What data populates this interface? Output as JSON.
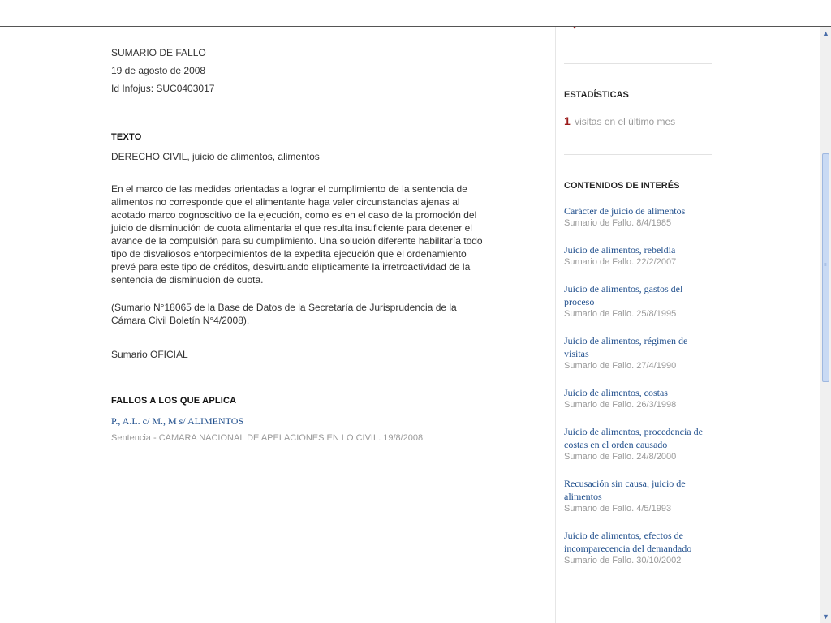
{
  "summary": {
    "type_label": "SUMARIO DE FALLO",
    "date": "19 de agosto de 2008",
    "id_line": "Id Infojus: SUC0403017"
  },
  "texto": {
    "title": "TEXTO",
    "keywords": "DERECHO CIVIL, juicio de alimentos, alimentos",
    "paragraph": "En el marco de las medidas orientadas a lograr el cumplimiento de la sentencia de alimentos no corresponde que el alimentante haga valer circunstancias ajenas al acotado marco cognoscitivo de la ejecución, como es en el caso de la promoción del juicio de disminución de cuota alimentaria el que resulta insuficiente para detener el avance de la compulsión para su cumplimiento. Una solución diferente habilitaría todo tipo de disvaliosos entorpecimientos de la expedita ejecución que el ordenamiento prevé para este tipo de créditos, desvirtuando elípticamente la irretroactividad de la sentencia de disminución de cuota.",
    "source": "(Sumario N°18065 de la Base de Datos de la Secretaría de Jurisprudencia de la Cámara Civil Boletín N°4/2008).",
    "oficial": "Sumario OFICIAL"
  },
  "fallos": {
    "title": "FALLOS A LOS QUE APLICA",
    "link": "P., A.L. c/ M., M s/ ALIMENTOS",
    "detail": "Sentencia - CAMARA NACIONAL DE APELACIONES EN LO CIVIL. 19/8/2008"
  },
  "sidebar": {
    "stats_title": "ESTADÍSTICAS",
    "visits_count": "1",
    "visits_label": "visitas en el último mes",
    "related_title": "CONTENIDOS DE INTERÉS",
    "items": [
      {
        "title": "Carácter de juicio de alimentos",
        "meta": "Sumario de Fallo. 8/4/1985"
      },
      {
        "title": "Juicio de alimentos, rebeldía",
        "meta": "Sumario de Fallo. 22/2/2007"
      },
      {
        "title": "Juicio de alimentos, gastos del proceso",
        "meta": "Sumario de Fallo. 25/8/1995"
      },
      {
        "title": "Juicio de alimentos, régimen de visitas",
        "meta": "Sumario de Fallo. 27/4/1990"
      },
      {
        "title": "Juicio de alimentos, costas",
        "meta": "Sumario de Fallo. 26/3/1998"
      },
      {
        "title": "Juicio de alimentos, procedencia de costas en el orden causado",
        "meta": "Sumario de Fallo. 24/8/2000"
      },
      {
        "title": "Recusación sin causa, juicio de alimentos",
        "meta": "Sumario de Fallo. 4/5/1993"
      },
      {
        "title": "Juicio de alimentos, efectos de incomparecencia del demandado",
        "meta": "Sumario de Fallo. 30/10/2002"
      }
    ]
  },
  "colors": {
    "link": "#1f4e8c",
    "accent_red": "#9b1b1b",
    "muted": "#999999"
  },
  "icons": {
    "scroll_up": "scroll-up-arrow-icon",
    "scroll_down": "scroll-down-arrow-icon"
  }
}
